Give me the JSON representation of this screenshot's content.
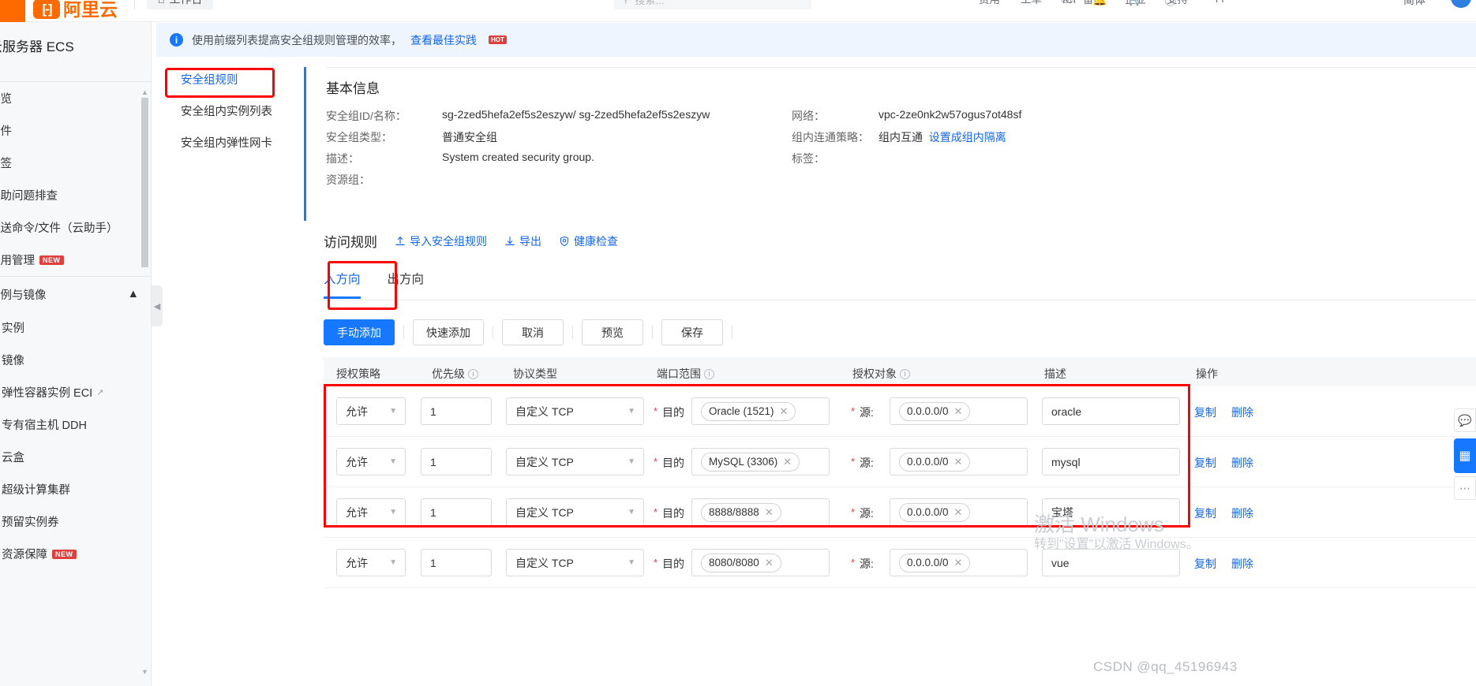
{
  "topbar": {
    "menu_icon": "hamburger-icon",
    "logo_text": "阿里云",
    "workbench": "工作台",
    "home_icon": "home-icon",
    "search_placeholder": "搜索...",
    "search_icon": "search-icon",
    "links": [
      "费用",
      "工单",
      "ICP 备案",
      "企业",
      "支持",
      "App"
    ],
    "icons": [
      "screen-icon",
      "bell-icon",
      "cart-icon",
      "help-icon"
    ],
    "language": "简体",
    "avatar": "user-avatar"
  },
  "sidebar": {
    "title": "云服务器 ECS",
    "items": [
      {
        "label": "概览",
        "badge": ""
      },
      {
        "label": "事件",
        "badge": ""
      },
      {
        "label": "标签",
        "badge": ""
      },
      {
        "label": "自助问题排查",
        "badge": ""
      },
      {
        "label": "发送命令/文件（云助手）",
        "badge": ""
      },
      {
        "label": "应用管理",
        "badge": "NEW"
      }
    ],
    "group": {
      "label": "实例与镜像",
      "chevron": "chevron-up-icon"
    },
    "subitems": [
      {
        "label": "实例",
        "external": false,
        "badge": ""
      },
      {
        "label": "镜像",
        "external": false,
        "badge": ""
      },
      {
        "label": "弹性容器实例 ECI",
        "external": true,
        "badge": ""
      },
      {
        "label": "专有宿主机 DDH",
        "external": false,
        "badge": ""
      },
      {
        "label": "云盒",
        "external": false,
        "badge": ""
      },
      {
        "label": "超级计算集群",
        "external": false,
        "badge": ""
      },
      {
        "label": "预留实例券",
        "external": false,
        "badge": ""
      },
      {
        "label": "资源保障",
        "external": false,
        "badge": "NEW"
      }
    ]
  },
  "nav2": {
    "items": [
      {
        "label": "安全组规则",
        "active": true
      },
      {
        "label": "安全组内实例列表",
        "active": false
      },
      {
        "label": "安全组内弹性网卡",
        "active": false
      }
    ]
  },
  "banner": {
    "icon": "info-icon",
    "text": "使用前缀列表提高安全组规则管理的效率，",
    "link": "查看最佳实践",
    "tag": "HOT"
  },
  "basic_info": {
    "title": "基本信息",
    "rows": [
      {
        "label": "安全组ID/名称：",
        "value": "sg-2zed5hefa2ef5s2eszyw/ sg-2zed5hefa2ef5s2eszyw",
        "label2": "网络：",
        "value2": "vpc-2ze0nk2w57ogus7ot48sf",
        "link2": ""
      },
      {
        "label": "安全组类型：",
        "value": "普通安全组",
        "label2": "组内连通策略：",
        "value2": "组内互通",
        "link2": "设置成组内隔离"
      },
      {
        "label": "描述：",
        "value": "System created security group.",
        "label2": "标签：",
        "value2": "",
        "link2": ""
      },
      {
        "label": "资源组：",
        "value": "",
        "label2": "",
        "value2": "",
        "link2": ""
      }
    ]
  },
  "rules": {
    "title": "访问规则",
    "actions": [
      {
        "label": "导入安全组规则",
        "icon": "import-icon"
      },
      {
        "label": "导出",
        "icon": "export-icon"
      },
      {
        "label": "健康检查",
        "icon": "shield-check-icon"
      }
    ],
    "tabs": [
      {
        "label": "入方向",
        "active": true
      },
      {
        "label": "出方向",
        "active": false
      }
    ],
    "toolbar": [
      {
        "label": "手动添加",
        "primary": true
      },
      {
        "label": "快速添加",
        "primary": false
      },
      {
        "label": "取消",
        "primary": false
      },
      {
        "label": "预览",
        "primary": false
      },
      {
        "label": "保存",
        "primary": false
      }
    ],
    "columns": [
      {
        "label": "授权策略",
        "info": false
      },
      {
        "label": "优先级",
        "info": true
      },
      {
        "label": "协议类型",
        "info": false
      },
      {
        "label": "端口范围",
        "info": true
      },
      {
        "label": "授权对象",
        "info": true
      },
      {
        "label": "描述",
        "info": false
      },
      {
        "label": "操作",
        "info": false
      }
    ],
    "dest_label": "目的",
    "src_label": "源:",
    "rows": [
      {
        "policy": "允许",
        "priority": "1",
        "protocol": "自定义 TCP",
        "port": "Oracle (1521)",
        "target": "0.0.0.0/0",
        "description": "oracle",
        "copy": "复制",
        "delete": "删除"
      },
      {
        "policy": "允许",
        "priority": "1",
        "protocol": "自定义 TCP",
        "port": "MySQL (3306)",
        "target": "0.0.0.0/0",
        "description": "mysql",
        "copy": "复制",
        "delete": "删除"
      },
      {
        "policy": "允许",
        "priority": "1",
        "protocol": "自定义 TCP",
        "port": "8888/8888",
        "target": "0.0.0.0/0",
        "description": "宝塔",
        "copy": "复制",
        "delete": "删除"
      },
      {
        "policy": "允许",
        "priority": "1",
        "protocol": "自定义 TCP",
        "port": "8080/8080",
        "target": "0.0.0.0/0",
        "description": "vue",
        "copy": "复制",
        "delete": "删除"
      }
    ]
  },
  "float_widgets": [
    {
      "name": "chat-icon",
      "glyph": "💬"
    },
    {
      "name": "grid-icon",
      "glyph": "▦"
    },
    {
      "name": "more-icon",
      "glyph": "⋯"
    }
  ],
  "watermark": {
    "activate_title": "激活 Windows",
    "activate_sub": "转到\"设置\"以激活 Windows。",
    "csdn": "CSDN @qq_45196943"
  },
  "colors": {
    "brand_orange": "#ff6a00",
    "primary_blue": "#1677ff",
    "link_blue": "#1366ec",
    "danger_red": "#e13e3e",
    "highlight_red": "#ff0000"
  }
}
